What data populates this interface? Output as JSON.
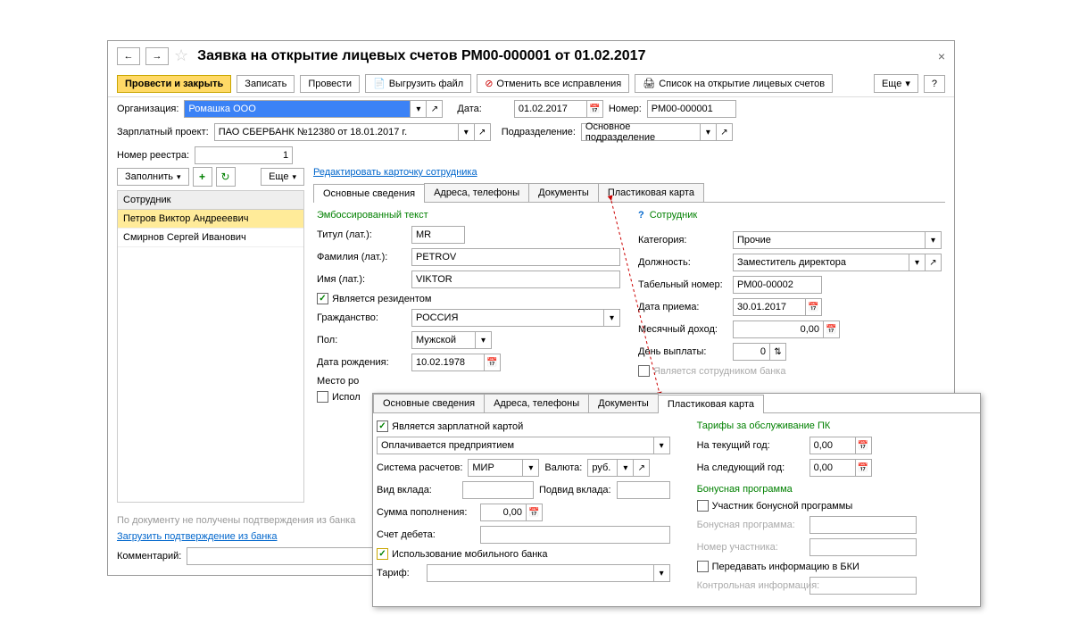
{
  "title": "Заявка на открытие лицевых счетов РМ00-000001 от 01.02.2017",
  "toolbar": {
    "post_close": "Провести и закрыть",
    "save": "Записать",
    "post": "Провести",
    "export_file": "Выгрузить файл",
    "cancel_corrections": "Отменить все исправления",
    "open_list": "Список на открытие лицевых счетов",
    "more": "Еще",
    "help": "?"
  },
  "form": {
    "org_label": "Организация:",
    "org_value": "Ромашка ООО",
    "date_label": "Дата:",
    "date_value": "01.02.2017",
    "number_label": "Номер:",
    "number_value": "РМ00-000001",
    "project_label": "Зарплатный проект:",
    "project_value": "ПАО СБЕРБАНК №12380   от 18.01.2017 г.",
    "dept_label": "Подразделение:",
    "dept_value": "Основное подразделение",
    "registry_label": "Номер реестра:",
    "registry_value": "1"
  },
  "left": {
    "fill": "Заполнить",
    "more": "Еще",
    "header": "Сотрудник",
    "rows": [
      "Петров Виктор Андрееевич",
      "Смирнов Сергей Иванович"
    ]
  },
  "edit_link": "Редактировать карточку сотрудника",
  "tabs": [
    "Основные сведения",
    "Адреса, телефоны",
    "Документы",
    "Пластиковая карта"
  ],
  "emboss": {
    "title": "Эмбоссированный текст",
    "titul_label": "Титул (лат.):",
    "titul_value": "MR",
    "surname_label": "Фамилия (лат.):",
    "surname_value": "PETROV",
    "name_label": "Имя (лат.):",
    "name_value": "VIKTOR",
    "resident": "Является резидентом",
    "citizenship_label": "Гражданство:",
    "citizenship_value": "РОССИЯ",
    "gender_label": "Пол:",
    "gender_value": "Мужской",
    "birth_label": "Дата рождения:",
    "birth_value": "10.02.1978",
    "birthplace_label": "Место ро",
    "ispol": "Испол"
  },
  "employee": {
    "title": "Сотрудник",
    "category_label": "Категория:",
    "category_value": "Прочие",
    "position_label": "Должность:",
    "position_value": "Заместитель директора",
    "tabnum_label": "Табельный номер:",
    "tabnum_value": "РМ00-00002",
    "hiredate_label": "Дата приема:",
    "hiredate_value": "30.01.2017",
    "income_label": "Месячный доход:",
    "income_value": "0,00",
    "payday_label": "День выплаты:",
    "payday_value": "0",
    "bank_emp": "Является сотрудником банка"
  },
  "footer": {
    "note": "По документу не получены подтверждения из банка",
    "load_link": "Загрузить подтверждение из банка",
    "comment_label": "Комментарий:"
  },
  "popup": {
    "salary_card": "Является зарплатной картой",
    "paid_by": "Оплачивается предприятием",
    "system_label": "Система расчетов:",
    "system_value": "МИР",
    "currency_label": "Валюта:",
    "currency_value": "руб.",
    "deposit_label": "Вид вклада:",
    "subdeposit_label": "Подвид вклада:",
    "topup_label": "Сумма пополнения:",
    "topup_value": "0,00",
    "debit_label": "Счет дебета:",
    "mobile_bank": "Использование мобильного банка",
    "tariff_label": "Тариф:",
    "tariffs_title": "Тарифы за обслуживание ПК",
    "current_year": "На текущий год:",
    "next_year": "На следующий год:",
    "tariff_zero": "0,00",
    "bonus_title": "Бонусная программа",
    "bonus_member": "Участник бонусной программы",
    "bonus_program": "Бонусная программа:",
    "member_num": "Номер участника:",
    "bki": "Передавать информацию в БКИ",
    "control_info": "Контрольная информация:"
  }
}
